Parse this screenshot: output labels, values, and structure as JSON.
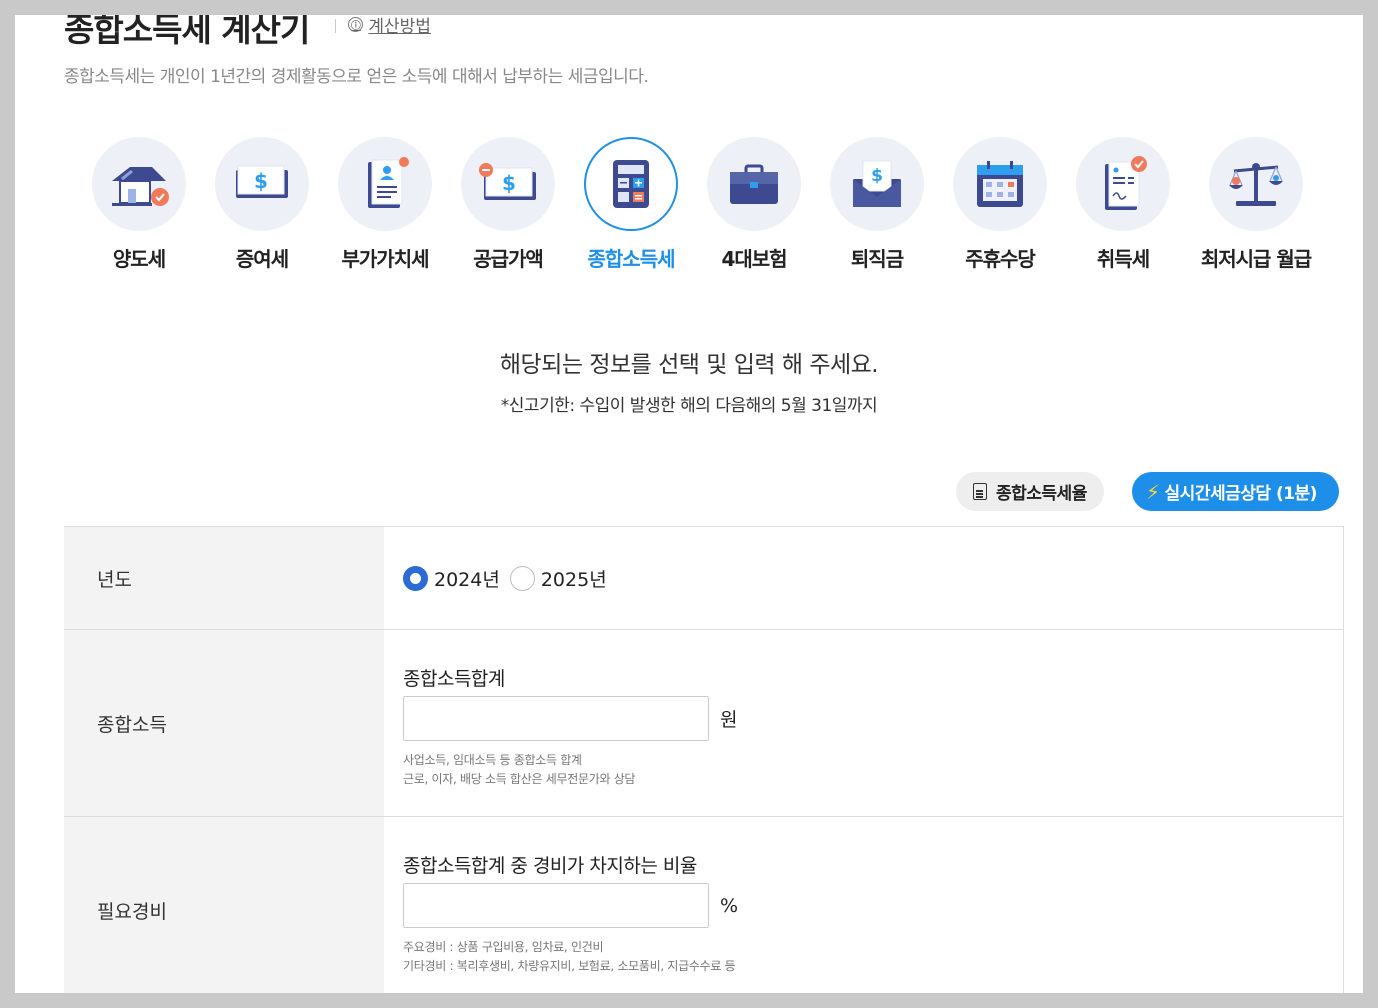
{
  "header": {
    "title": "종합소득세 계산기",
    "method_icon": "ⓘ",
    "method_link": "계산방법",
    "subtitle": "종합소득세는 개인이 1년간의 경제활동으로 얻은 소득에 대해서 납부하는 세금입니다."
  },
  "categories": [
    {
      "label": "양도세",
      "icon": "house-icon",
      "active": false
    },
    {
      "label": "증여세",
      "icon": "money-tray-icon",
      "active": false
    },
    {
      "label": "부가가치세",
      "icon": "document-person-icon",
      "active": false
    },
    {
      "label": "공급가액",
      "icon": "money-minus-icon",
      "active": false
    },
    {
      "label": "종합소득세",
      "icon": "calculator-icon",
      "active": true
    },
    {
      "label": "4대보험",
      "icon": "briefcase-icon",
      "active": false
    },
    {
      "label": "퇴직금",
      "icon": "envelope-money-icon",
      "active": false
    },
    {
      "label": "주휴수당",
      "icon": "calendar-icon",
      "active": false
    },
    {
      "label": "취득세",
      "icon": "contract-icon",
      "active": false
    },
    {
      "label": "최저시급 월급",
      "icon": "scales-icon",
      "active": false
    }
  ],
  "guide": {
    "main": "해당되는 정보를 선택 및 입력 해 주세요.",
    "sub": "*신고기한: 수입이 발생한 해의 다음해의 5월 31일까지"
  },
  "buttons": {
    "rates": "종합소득세율",
    "consult": "실시간세금상담 (1분)",
    "bolt": "⚡"
  },
  "form": {
    "year": {
      "label": "년도",
      "options": [
        "2024년",
        "2025년"
      ],
      "selected": "2024년"
    },
    "income": {
      "label": "종합소득",
      "field_title": "종합소득합계",
      "value": "",
      "unit": "원",
      "help": [
        "사업소득, 임대소득 등 종합소득 합계",
        "근로, 이자, 배당 소득 합산은 세무전문가와 상담"
      ]
    },
    "expense": {
      "label": "필요경비",
      "field_title": "종합소득합계 중 경비가 차지하는 비율",
      "value": "",
      "unit": "%",
      "help": [
        "주요경비 : 상품 구입비용, 임차료, 인건비",
        "기타경비 : 복리후생비, 차량유지비, 보험료, 소모품비, 지급수수료 등"
      ]
    }
  },
  "colors": {
    "accent": "#1e8fe8",
    "radio": "#2d6bd4",
    "icon_navy": "#3d4a8f",
    "icon_orange": "#f07a5a",
    "icon_blue": "#2d9ef0"
  }
}
